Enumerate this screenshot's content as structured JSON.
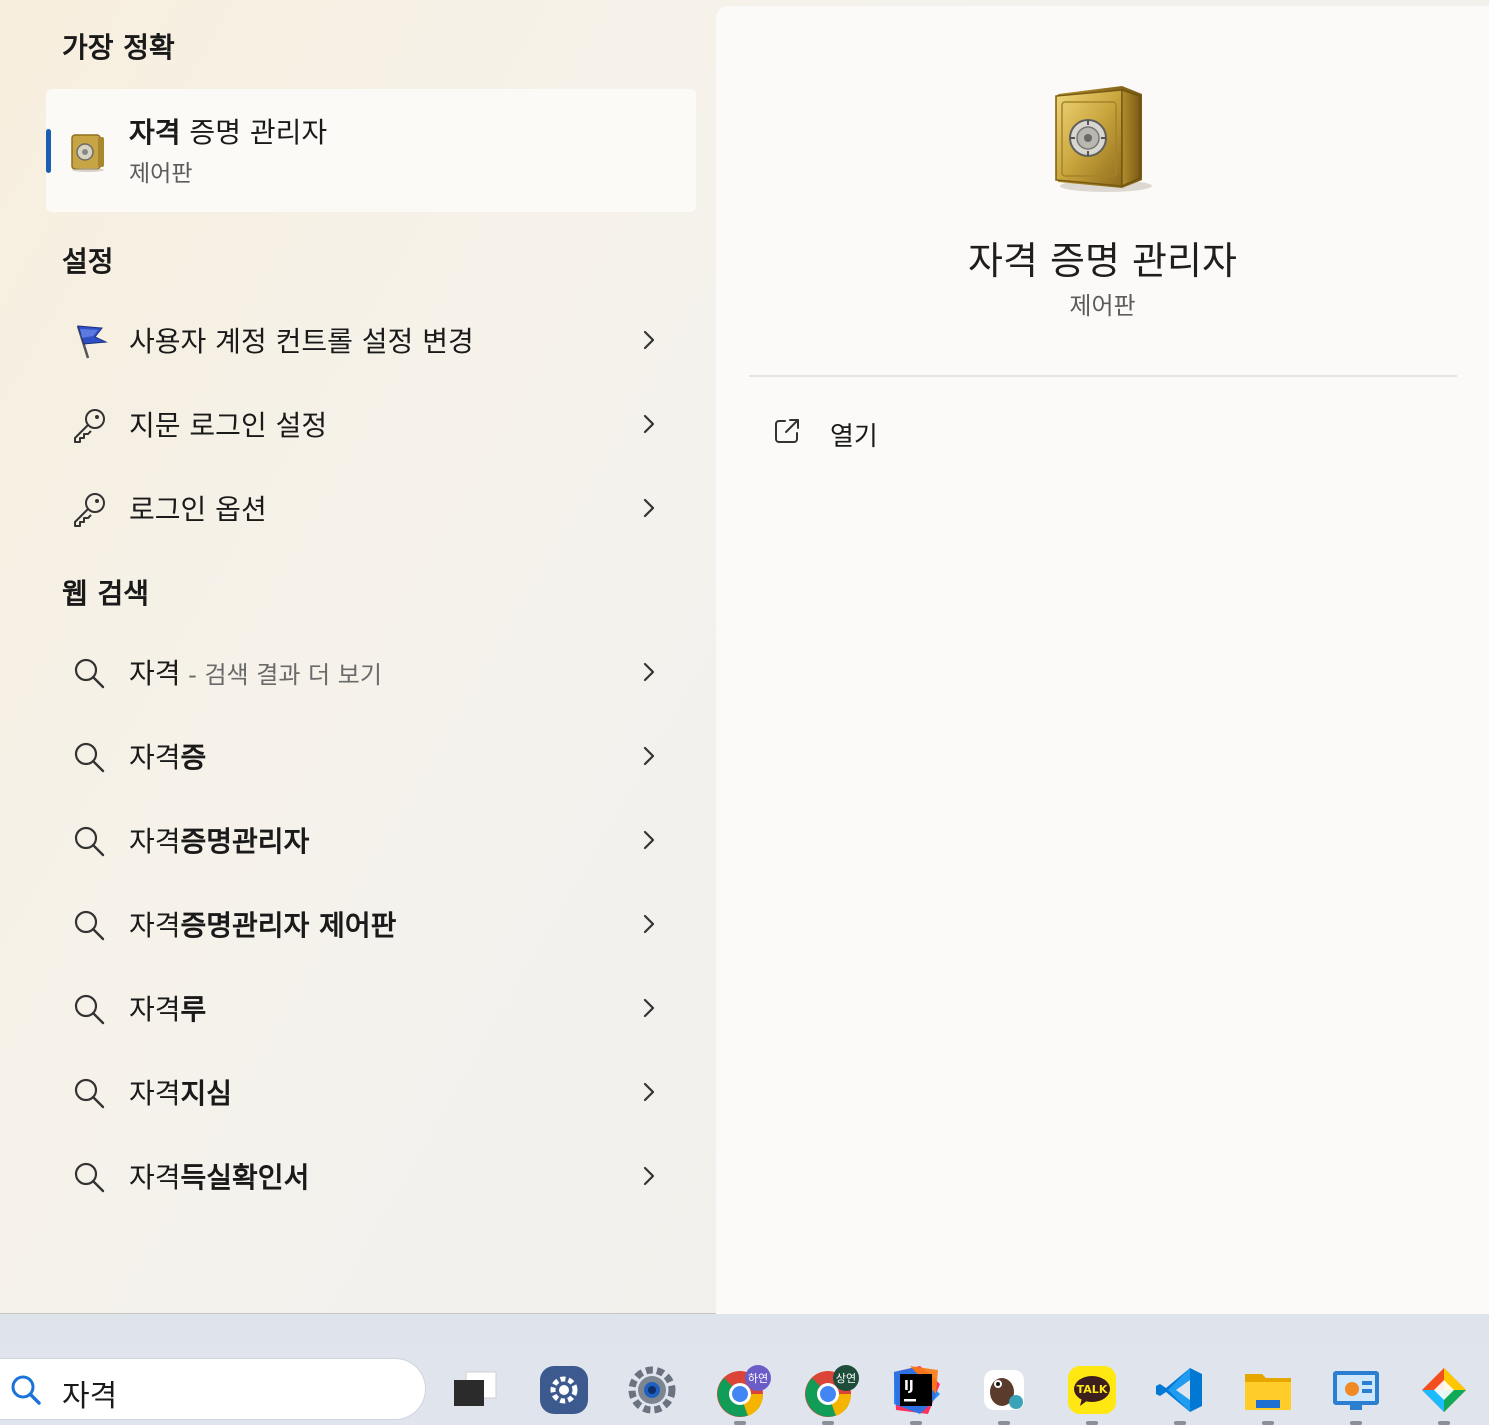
{
  "best_match": {
    "section_title": "가장 정확",
    "title_bold": "자격",
    "title_rest": " 증명 관리자",
    "subtitle": "제어판"
  },
  "settings": {
    "section_title": "설정",
    "items": [
      {
        "label": "사용자 계정 컨트롤 설정 변경",
        "icon": "uac-flag-icon"
      },
      {
        "label": "지문 로그인 설정",
        "icon": "key-icon"
      },
      {
        "label": "로그인 옵션",
        "icon": "key-icon"
      }
    ]
  },
  "web_search": {
    "section_title": "웹 검색",
    "items": [
      {
        "prefix": "자격",
        "bold": "",
        "muted": " - 검색 결과 더 보기"
      },
      {
        "prefix": "자격",
        "bold": "증",
        "muted": ""
      },
      {
        "prefix": "자격",
        "bold": "증명관리자",
        "muted": ""
      },
      {
        "prefix": "자격",
        "bold": "증명관리자 제어판",
        "muted": ""
      },
      {
        "prefix": "자격",
        "bold": "루",
        "muted": ""
      },
      {
        "prefix": "자격",
        "bold": "지심",
        "muted": ""
      },
      {
        "prefix": "자격",
        "bold": "득실확인서",
        "muted": ""
      }
    ]
  },
  "detail": {
    "title": "자격 증명 관리자",
    "subtitle": "제어판",
    "actions": [
      {
        "label": "열기",
        "icon": "open-external-icon"
      }
    ]
  },
  "taskbar": {
    "search_text": "자격",
    "chrome_badge_1": "하연",
    "chrome_badge_2": "상연",
    "kakao_label": "TALK",
    "intellij_label": "IJ",
    "colors": {
      "accent": "#1a5fb4",
      "search_icon": "#1a73d9"
    }
  }
}
